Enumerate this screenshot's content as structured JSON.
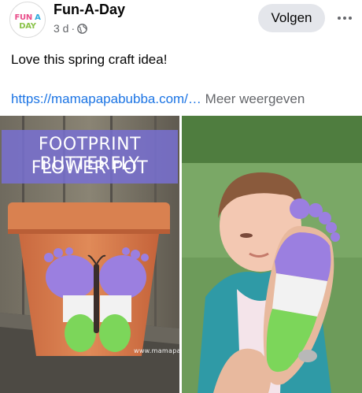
{
  "post": {
    "page_name": "Fun-A-Day",
    "avatar_text": "FUN A DAY",
    "time": "3 d",
    "separator": "·",
    "privacy_icon": "globe-icon",
    "follow_label": "Volgen",
    "more_icon": "more-horizontal-icon",
    "text": "Love this spring craft idea!",
    "link": "https://mamapapabubba.com/…",
    "see_more": "Meer weergeven"
  },
  "photos": {
    "left": {
      "title_line1": "FOOTPRINT BUTTERFLY",
      "title_line2": "FLOWER POT",
      "watermark": "www.mamapapabubba.com"
    }
  },
  "colors": {
    "link": "#1b74e4",
    "secondary_text": "#65676b",
    "button_bg": "#e4e6eb",
    "banner": "#7870d2",
    "paint_purple": "#9b7fe0",
    "paint_white": "#f2f2f2",
    "paint_green": "#7cd65a",
    "pot": "#d6784a"
  }
}
